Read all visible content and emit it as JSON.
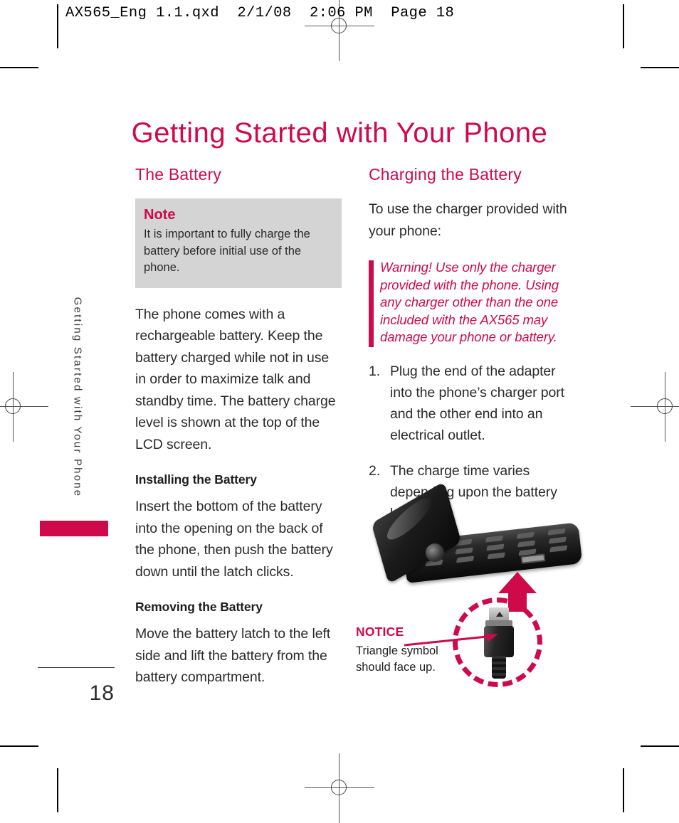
{
  "slug": "AX565_Eng 1.1.qxd  2/1/08  2:06 PM  Page 18",
  "page_title": "Getting Started with Your Phone",
  "side_tab": "Getting Started with Your Phone",
  "folio": "18",
  "colors": {
    "accent": "#cf0a4b",
    "note_background": "#d4d4d4",
    "body_text": "#2a2a2a"
  },
  "left_column": {
    "heading": "The Battery",
    "note": {
      "title": "Note",
      "body": "It is important to fully charge the battery before initial use of the phone."
    },
    "intro_paragraph": "The phone comes with a rechargeable battery. Keep the battery charged while not in use in order to maximize talk and standby time. The battery charge level is shown at the top of the LCD screen.",
    "installing": {
      "heading": "Installing the Battery",
      "body": "Insert the bottom of the battery into the opening on the back of the phone, then push the battery down until the latch clicks."
    },
    "removing": {
      "heading": "Removing the Battery",
      "body": "Move the battery latch to the left side and lift the battery from the battery compartment."
    }
  },
  "right_column": {
    "heading": "Charging the Battery",
    "intro_paragraph": "To use the charger provided with your phone:",
    "warning": "Warning! Use only the charger provided with the phone. Using any charger other than the one included with the AX565 may damage your phone or battery.",
    "steps": [
      {
        "number": "1.",
        "text": "Plug the end of the adapter into the phone’s charger port and the other end into an electrical outlet."
      },
      {
        "number": "2.",
        "text": "The charge time varies depending upon the battery level."
      }
    ],
    "figure": {
      "notice_label": "NOTICE",
      "notice_body": "Triangle symbol should face up."
    }
  }
}
